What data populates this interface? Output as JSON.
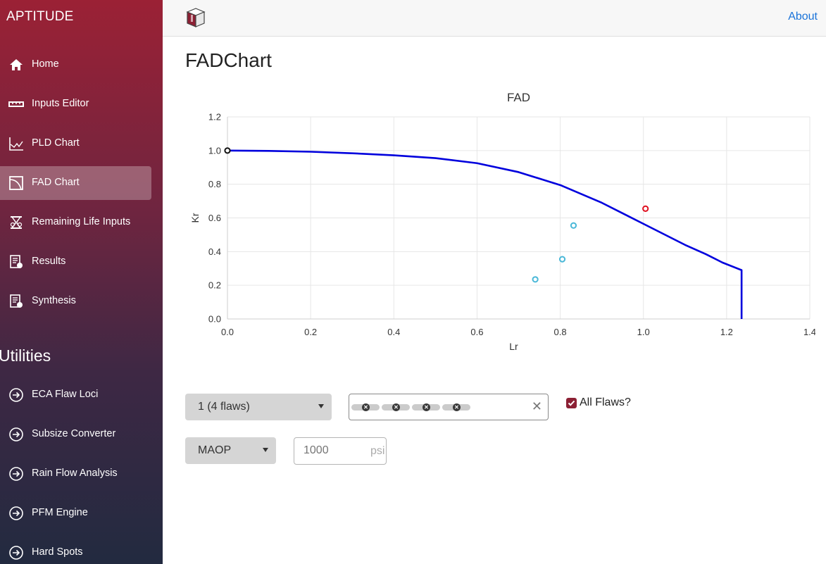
{
  "app": {
    "brand": "APTITUDE"
  },
  "nav": [
    {
      "label": "Home",
      "icon": "home-icon",
      "active": false
    },
    {
      "label": "Inputs Editor",
      "icon": "ruler-icon",
      "active": false
    },
    {
      "label": "PLD Chart",
      "icon": "line-chart-icon",
      "active": false
    },
    {
      "label": "FAD Chart",
      "icon": "fad-chart-icon",
      "active": true
    },
    {
      "label": "Remaining Life Inputs",
      "icon": "hourglass-icon",
      "active": false
    },
    {
      "label": "Results",
      "icon": "report-icon",
      "active": false
    },
    {
      "label": "Synthesis",
      "icon": "report-icon",
      "active": false
    }
  ],
  "utilities": {
    "title": "Utilities",
    "items": [
      {
        "label": "ECA Flaw Loci",
        "icon": "circle-arrow-right-icon"
      },
      {
        "label": "Subsize Converter",
        "icon": "circle-arrow-right-icon"
      },
      {
        "label": "Rain Flow Analysis",
        "icon": "circle-arrow-right-icon"
      },
      {
        "label": "PFM Engine",
        "icon": "circle-arrow-right-icon"
      },
      {
        "label": "Hard Spots",
        "icon": "circle-arrow-right-icon"
      }
    ]
  },
  "topbar": {
    "about": "About"
  },
  "page": {
    "title": "FADChart"
  },
  "controls": {
    "flaw_select": "1 (4 flaws)",
    "tag_count": 4,
    "all_flaws_label": "All Flaws?",
    "all_flaws_checked": true,
    "pressure_select": "MAOP",
    "pressure_placeholder": "1000",
    "pressure_unit": "psi"
  },
  "colors": {
    "curve": "#0000dd",
    "flaw_points": "#4ab8d8",
    "critical_point": "#e01020",
    "accent": "#8c2034"
  },
  "chart_data": {
    "type": "line",
    "title": "FAD",
    "xlabel": "Lr",
    "ylabel": "Kr",
    "xlim": [
      0,
      1.4
    ],
    "ylim": [
      0,
      1.2
    ],
    "xticks": [
      "0.0",
      "0.2",
      "0.4",
      "0.6",
      "0.8",
      "1.0",
      "1.2",
      "1.4"
    ],
    "yticks": [
      "0.0",
      "0.2",
      "0.4",
      "0.6",
      "0.8",
      "1.0",
      "1.2"
    ],
    "grid": true,
    "series": [
      {
        "kind": "line",
        "color": "#0000dd",
        "x": [
          0,
          0.1,
          0.2,
          0.3,
          0.4,
          0.5,
          0.6,
          0.7,
          0.8,
          0.9,
          1.0,
          1.1,
          1.15,
          1.19,
          1.236,
          1.236
        ],
        "y": [
          1.0,
          0.998,
          0.993,
          0.984,
          0.972,
          0.955,
          0.925,
          0.872,
          0.795,
          0.69,
          0.565,
          0.44,
          0.385,
          0.335,
          0.29,
          0.0
        ]
      },
      {
        "kind": "scatter",
        "color": "#4ab8d8",
        "x": [
          0.74,
          0.805,
          0.832
        ],
        "y": [
          0.235,
          0.355,
          0.555
        ]
      },
      {
        "kind": "scatter",
        "color": "#e01020",
        "x": [
          1.005
        ],
        "y": [
          0.655
        ]
      },
      {
        "kind": "scatter",
        "color": "#111111",
        "x": [
          0.0
        ],
        "y": [
          1.0
        ]
      }
    ]
  }
}
